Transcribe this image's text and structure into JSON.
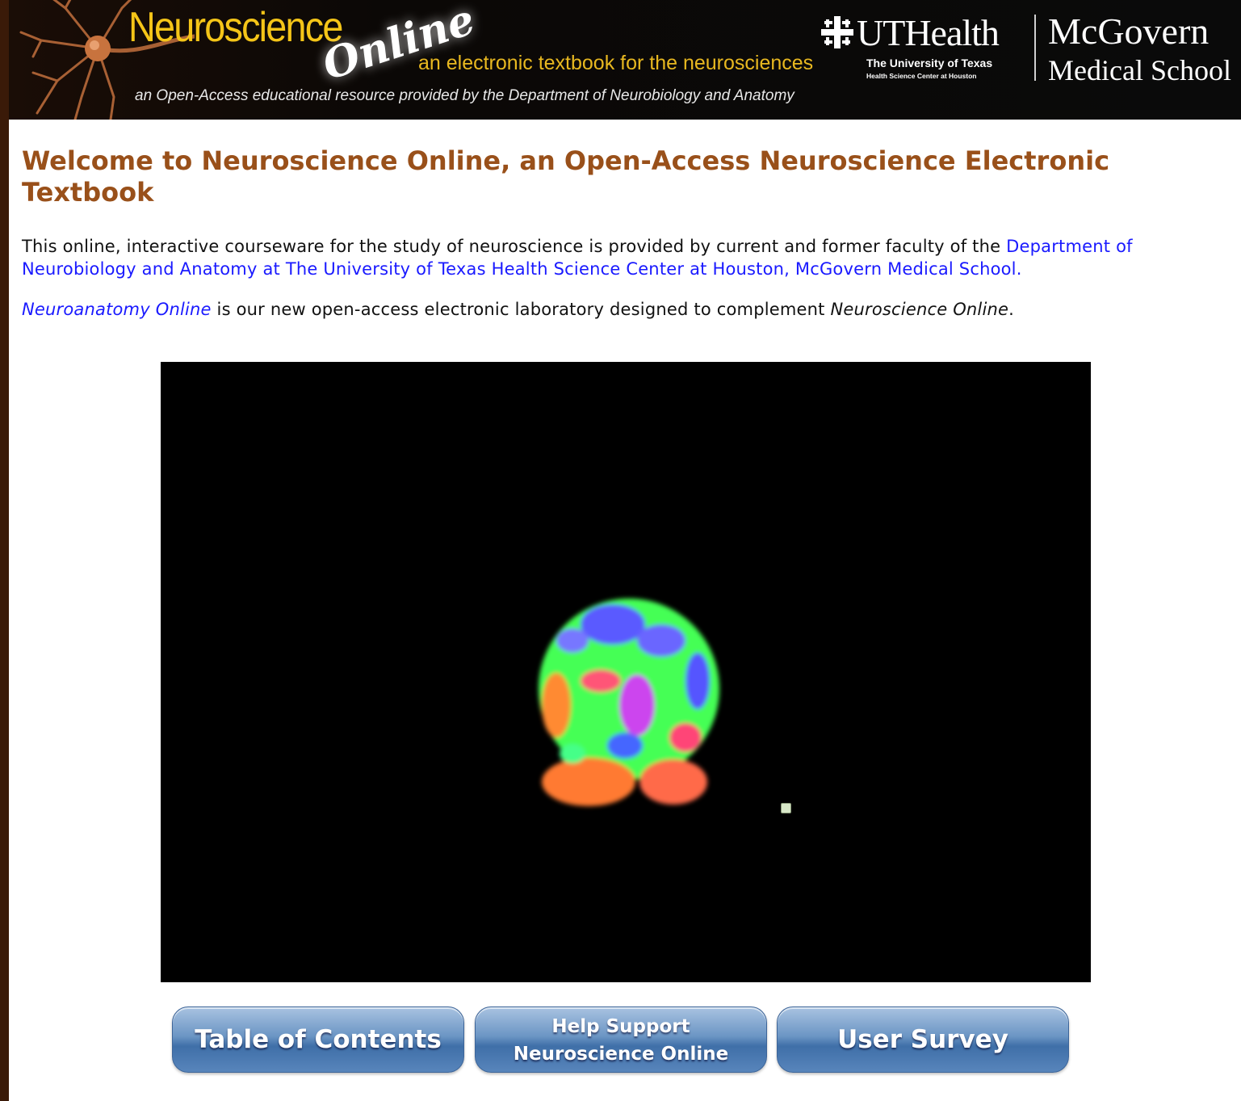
{
  "banner": {
    "brand_word": "Neuroscience",
    "brand_online": "Online",
    "tagline": "an electronic textbook for the neurosciences",
    "subtagline": "an Open-Access educational resource provided by the Department of Neurobiology and Anatomy",
    "ut_name": "UTHealth",
    "ut_sub1": "The University of Texas",
    "ut_sub2": "Health Science Center at Houston",
    "school_line1": "McGovern",
    "school_line2": "Medical School"
  },
  "main": {
    "heading": "Welcome to Neuroscience Online, an Open-Access Neuroscience Electronic Textbook",
    "para1_text": "This online, interactive courseware for the study of neuroscience is provided by current and former faculty of the ",
    "para1_link": "Department of Neurobiology and Anatomy at The University of Texas Health Science Center at Houston, McGovern Medical School.",
    "para2_link": "Neuroanatomy Online",
    "para2_text": " is our new open-access electronic laboratory designed to complement ",
    "para2_ital": "Neuroscience Online",
    "para2_end": "."
  },
  "buttons": {
    "toc": "Table of Contents",
    "support": "Help Support\nNeuroscience Online",
    "survey": "User Survey"
  },
  "colors": {
    "heading": "#99501a",
    "link": "#1a1aff",
    "tagline": "#e8b820",
    "button": "#5885bb"
  }
}
